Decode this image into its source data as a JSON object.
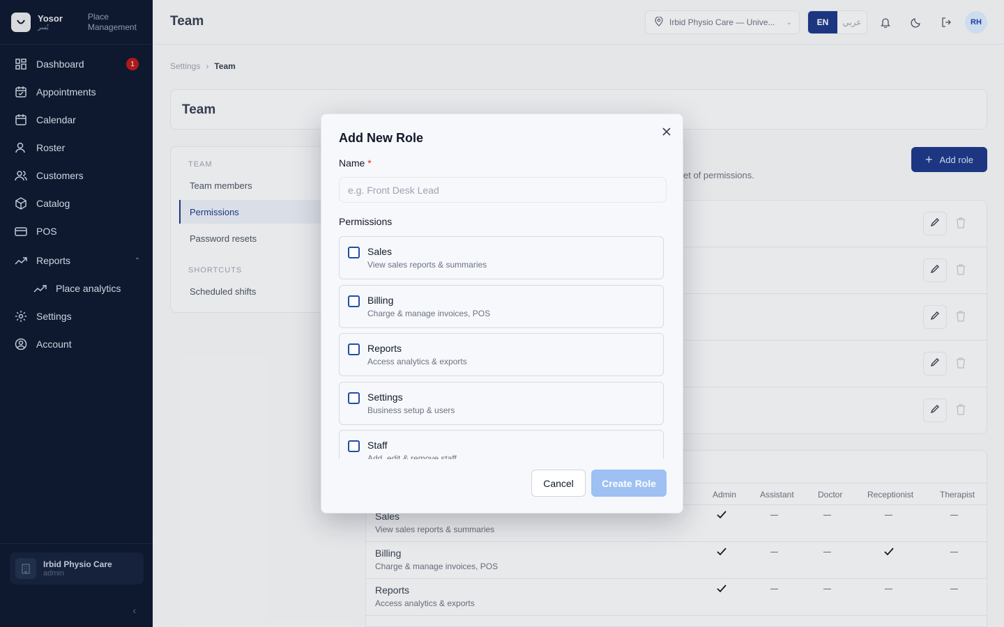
{
  "brand": {
    "name": "Yosor",
    "sub": "يُسر",
    "tag_line1": "Place",
    "tag_line2": "Management"
  },
  "sidebar": {
    "items": [
      {
        "label": "Dashboard",
        "icon": "grid-icon",
        "badge": "1"
      },
      {
        "label": "Appointments",
        "icon": "calendar-check-icon"
      },
      {
        "label": "Calendar",
        "icon": "calendar-icon"
      },
      {
        "label": "Roster",
        "icon": "user-icon"
      },
      {
        "label": "Customers",
        "icon": "users-icon"
      },
      {
        "label": "Catalog",
        "icon": "box-icon"
      },
      {
        "label": "POS",
        "icon": "card-icon"
      },
      {
        "label": "Reports",
        "icon": "trend-icon"
      },
      {
        "label": "Place analytics",
        "icon": "trend-icon"
      },
      {
        "label": "Settings",
        "icon": "gear-icon"
      },
      {
        "label": "Account",
        "icon": "user-circle-icon"
      }
    ],
    "place": {
      "name": "Irbid Physio Care",
      "role": "admin"
    }
  },
  "header": {
    "title": "Team",
    "location": "Irbid Physio Care — Unive...",
    "lang_en": "EN",
    "lang_ar": "عربي",
    "avatar": "RH"
  },
  "breadcrumb": {
    "parent": "Settings",
    "current": "Team"
  },
  "page": {
    "title": "Team",
    "add_role": "Add role",
    "desc_tail": "et of permissions."
  },
  "subnav": {
    "section_team": "TEAM",
    "team_members": "Team members",
    "permissions": "Permissions",
    "password_resets": "Password resets",
    "section_shortcuts": "SHORTCUTS",
    "scheduled_shifts": "Scheduled shifts"
  },
  "matrix": {
    "columns": [
      "Admin",
      "Assistant",
      "Doctor",
      "Receptionist",
      "Therapist"
    ],
    "rows": [
      {
        "name": "Sales",
        "desc": "View sales reports & summaries",
        "values": [
          true,
          false,
          false,
          false,
          false
        ]
      },
      {
        "name": "Billing",
        "desc": "Charge & manage invoices, POS",
        "values": [
          true,
          false,
          false,
          true,
          false
        ]
      },
      {
        "name": "Reports",
        "desc": "Access analytics & exports",
        "values": [
          true,
          false,
          false,
          false,
          false
        ]
      }
    ]
  },
  "modal": {
    "title": "Add New Role",
    "name_label": "Name",
    "required_mark": "*",
    "name_placeholder": "e.g. Front Desk Lead",
    "name_value": "",
    "permissions_label": "Permissions",
    "permissions": [
      {
        "title": "Sales",
        "desc": "View sales reports & summaries",
        "checked": false
      },
      {
        "title": "Billing",
        "desc": "Charge & manage invoices, POS",
        "checked": false
      },
      {
        "title": "Reports",
        "desc": "Access analytics & exports",
        "checked": false
      },
      {
        "title": "Settings",
        "desc": "Business setup & users",
        "checked": false
      },
      {
        "title": "Staff",
        "desc": "Add, edit & remove staff",
        "checked": false
      }
    ],
    "cancel": "Cancel",
    "create": "Create Role"
  },
  "colors": {
    "sidebar_bg": "#0f1b33",
    "accent": "#1e3a8a",
    "create_disabled": "#9ec0f2",
    "badge": "#b91c1c"
  }
}
